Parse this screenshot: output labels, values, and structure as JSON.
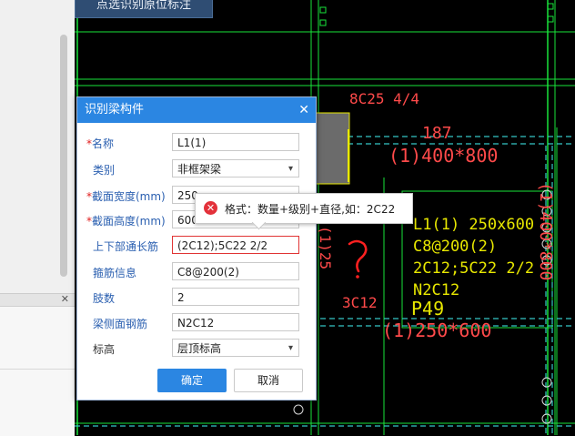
{
  "top_button": {
    "label": "点选识别原位标注"
  },
  "dialog": {
    "title": "识别梁构件",
    "close_icon": "close-icon",
    "fields": [
      {
        "required": true,
        "label": "名称",
        "value": "L1(1)",
        "type": "text"
      },
      {
        "required": false,
        "label": "类别",
        "value": "非框架梁",
        "type": "select"
      },
      {
        "required": true,
        "label": "截面宽度(mm)",
        "value": "250",
        "type": "text"
      },
      {
        "required": true,
        "label": "截面高度(mm)",
        "value": "600",
        "type": "text"
      },
      {
        "required": false,
        "label": "上下部通长筋",
        "value": "(2C12);5C22 2/2",
        "type": "text",
        "error": true
      },
      {
        "required": false,
        "label": "箍筋信息",
        "value": "C8@200(2)",
        "type": "text"
      },
      {
        "required": false,
        "label": "肢数",
        "value": "2",
        "type": "text"
      },
      {
        "required": false,
        "label": "梁侧面钢筋",
        "value": "N2C12",
        "type": "text"
      },
      {
        "required": false,
        "label": "标高",
        "value": "层顶标高",
        "type": "select",
        "label_color": "black"
      }
    ],
    "ok_label": "确定",
    "cancel_label": "取消"
  },
  "tooltip": {
    "icon": "error-icon",
    "message": "格式：数量+级别+直径,如：2C22"
  },
  "cad": {
    "texts": {
      "top_label": "8C25 4/4",
      "dim_top": "187",
      "section_top": "(1)400*800",
      "beam_line1": "L1(1) 250x600",
      "beam_line2": "C8@200(2)",
      "beam_line3": "2C12;5C22 2/2",
      "beam_line4": "N2C12",
      "left_label": "3C12",
      "p_label": "P49",
      "section_bottom": "(1)250*600",
      "vert_left": "(1)25",
      "vert_right": "(1)400*800",
      "question": "?"
    },
    "colors": {
      "green": "#19e33a",
      "yellow": "#e8e800",
      "red_text": "#ff4a4a",
      "cyan_dash": "#35c6c6",
      "annotation_red": "#ff2020"
    }
  },
  "left_panel": {
    "close_icon": "close-icon"
  }
}
